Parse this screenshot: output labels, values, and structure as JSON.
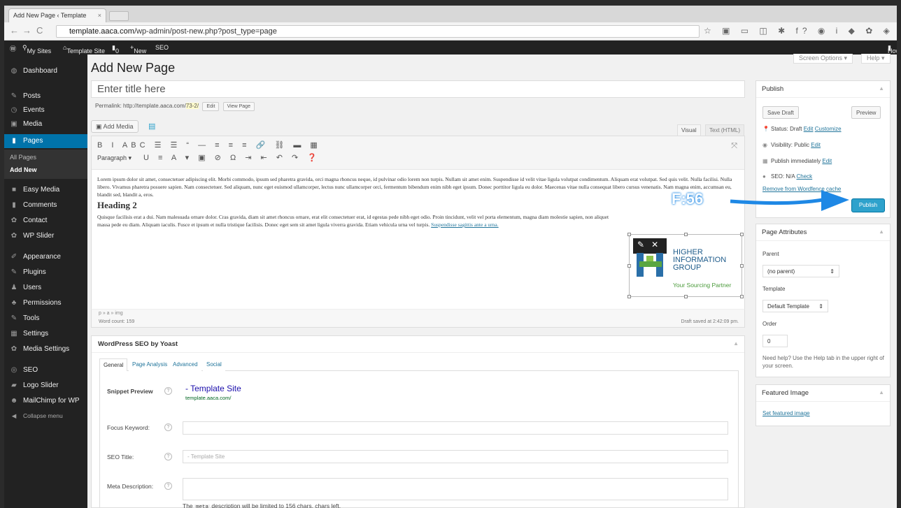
{
  "browser": {
    "tab_title": "Add New Page ‹ Template",
    "url_host": "template.aaca.com",
    "url_path": "/wp-admin/post-new.php?post_type=page",
    "ext_icons": "☆ ▣ ▭ ◫ ✱ f? ◉ i ◆ ✿ ◈ ▦ ≡"
  },
  "adminbar": {
    "my_sites": "My Sites",
    "site": "Template Site",
    "comments": "0",
    "new": "New",
    "seo": "SEO",
    "howdy": "Howdy, higwebadmin"
  },
  "sidebar": {
    "dashboard": "Dashboard",
    "posts": "Posts",
    "events": "Events",
    "media": "Media",
    "pages": "Pages",
    "all_pages": "All Pages",
    "add_new": "Add New",
    "easy_media": "Easy Media",
    "comments": "Comments",
    "contact": "Contact",
    "wp_slider": "WP Slider",
    "appearance": "Appearance",
    "plugins": "Plugins",
    "users": "Users",
    "permissions": "Permissions",
    "tools": "Tools",
    "settings": "Settings",
    "media_settings": "Media Settings",
    "seo": "SEO",
    "logo_slider": "Logo Slider",
    "mailchimp": "MailChimp for WP",
    "collapse": "Collapse menu"
  },
  "main": {
    "heading": "Add New Page",
    "screen_options": "Screen Options ▾",
    "help": "Help ▾",
    "title_placeholder": "Enter title here",
    "permalink_label": "Permalink:",
    "permalink_url": "http://template.aaca.com/",
    "permalink_slug": "73-2/",
    "edit_btn": "Edit",
    "view_btn": "View Page",
    "add_media": "Add Media",
    "tab_visual": "Visual",
    "tab_text": "Text (HTML)",
    "toolbar_row1": "B I ABC ☰ ☰ “ — ≡ ≡ ≡ 🔗 ⛓ ▬ ▦",
    "paragraph": "Paragraph ▾",
    "toolbar_row2": "U ≡ A ▾ ▣ ⊘ Ω ⇥ ⇤ ↶ ↷ ❓",
    "para1": "Lorem ipsum dolor sit amet, consectetuer adipiscing elit. Morbi commodo, ipsum sed pharetra gravida, orci magna rhoncus neque, id pulvinar odio lorem non turpis. Nullam sit amet enim. Suspendisse id velit vitae ligula volutpat condimentum. Aliquam erat volutpat. Sed quis velit. Nulla facilisi. Nulla libero. Vivamus pharetra posuere sapien. Nam consectetuer. Sed aliquam, nunc eget euismod ullamcorper, lectus nunc ullamcorper orci, fermentum bibendum enim nibh eget ipsum. Donec porttitor ligula eu dolor. Maecenas vitae nulla consequat libero cursus venenatis. Nam magna enim, accumsan eu, blandit sed, blandit a, eros.",
    "heading2": "Heading 2",
    "para2": "Quisque facilisis erat a dui. Nam malesuada ornare dolor. Cras gravida, diam sit amet rhoncus ornare, erat elit consectetuer erat, id egestas pede nibh eget odio. Proin tincidunt, velit vel porta elementum, magna diam molestie sapien, non aliquet massa pede eu diam. Aliquam iaculis. Fusce et ipsum et nulla tristique facilisis. Donec eget sem sit amet ligula viverra gravida. Etiam vehicula urna vel turpis.",
    "para2_link": "Suspendisse sagittis ante a urna.",
    "logo_line1": "HIGHER",
    "logo_line2": "INFORMATION",
    "logo_line3": "GROUP",
    "logo_tagline": "Your Sourcing Partner",
    "path": "p » a » img",
    "word_count": "Word count: 159",
    "draft_saved": "Draft saved at 2:42:09 pm."
  },
  "seo_box": {
    "title": "WordPress SEO by Yoast",
    "tabs": [
      "General",
      "Page Analysis",
      "Advanced",
      "Social"
    ],
    "snippet_label": "Snippet Preview",
    "snippet_title": "- Template Site",
    "snippet_url": "template.aaca.com/",
    "focus_label": "Focus Keyword:",
    "seotitle_label": "SEO Title:",
    "seotitle_placeholder": "- Template Site",
    "meta_label": "Meta Description:",
    "meta_note_pre": "The",
    "meta_note_code": "meta",
    "meta_note_post": "description will be limited to 156 chars, chars left."
  },
  "publish": {
    "title": "Publish",
    "save_draft": "Save Draft",
    "preview": "Preview",
    "status": "Status: Draft",
    "edit": "Edit",
    "customize": "Customize",
    "visibility": "Visibility: Public",
    "publish_imm": "Publish immediately",
    "seo": "SEO: N/A",
    "check": "Check",
    "remove_cache": "Remove from Wordfence cache",
    "publish_btn": "Publish"
  },
  "attributes": {
    "title": "Page Attributes",
    "parent_label": "Parent",
    "parent_value": "(no parent)",
    "template_label": "Template",
    "template_value": "Default Template",
    "order_label": "Order",
    "order_value": "0",
    "help": "Need help? Use the Help tab in the upper right of your screen."
  },
  "featured": {
    "title": "Featured Image",
    "link": "Set featured image"
  },
  "annotation": {
    "label": "F:56",
    "color": "#1e88e5"
  }
}
